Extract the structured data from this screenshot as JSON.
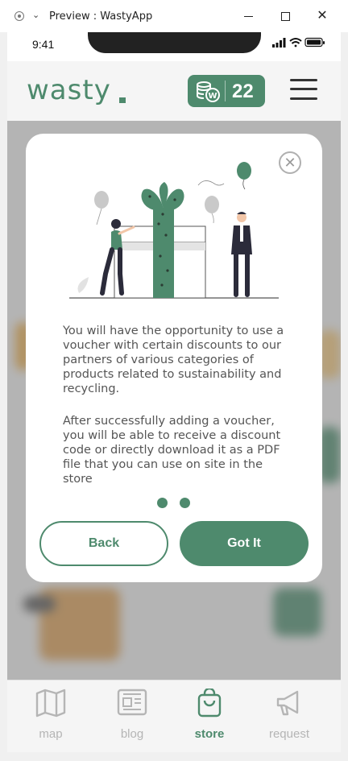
{
  "window": {
    "title": "Preview : WastyApp"
  },
  "status_bar": {
    "time": "9:41"
  },
  "header": {
    "logo": "wasty",
    "coins": "22"
  },
  "modal": {
    "paragraph1": "You will have the opportunity to use a voucher with certain discounts to our partners of various categories of products related to sustainability and recycling.",
    "paragraph2": "After successfully adding a voucher, you will be able to receive a discount code or directly download it as a PDF file that you can use on site in the store",
    "back_label": "Back",
    "got_it_label": "Got It",
    "page_dots": 2
  },
  "bottom_nav": {
    "items": [
      {
        "label": "map",
        "icon": "map-icon",
        "active": false
      },
      {
        "label": "blog",
        "icon": "blog-icon",
        "active": false
      },
      {
        "label": "store",
        "icon": "shopping-bag-icon",
        "active": true
      },
      {
        "label": "request",
        "icon": "megaphone-icon",
        "active": false
      }
    ]
  },
  "colors": {
    "accent": "#4e8a6d",
    "inactive": "#b5b5b5"
  }
}
